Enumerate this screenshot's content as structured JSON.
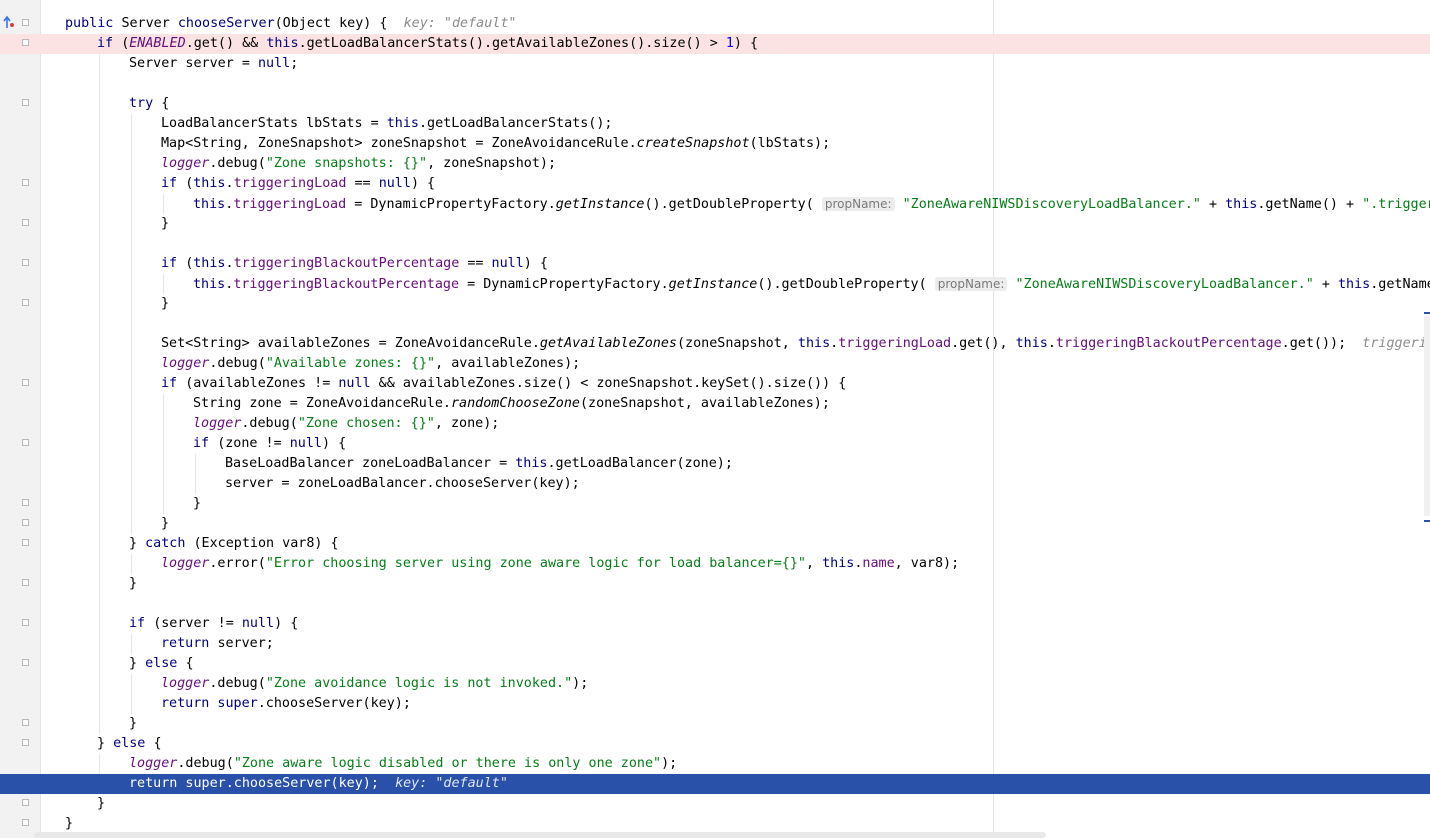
{
  "editor": {
    "lines": [
      {
        "parts": [
          [
            "kw",
            "public "
          ],
          [
            "",
            "Server "
          ],
          [
            "kw",
            "chooseServer"
          ],
          [
            "",
            "(Object key) {  "
          ],
          [
            "hint",
            "key: \"default\""
          ]
        ]
      },
      {
        "parts": [
          [
            "kw",
            "if "
          ],
          [
            "",
            "("
          ],
          [
            "fld ital",
            "ENABLED"
          ],
          [
            "",
            ".get() && "
          ],
          [
            "kw",
            "this"
          ],
          [
            "",
            ".getLoadBalancerStats().getAvailableZones().size() > "
          ],
          [
            "num",
            "1"
          ],
          [
            "",
            ") {"
          ]
        ]
      },
      {
        "parts": [
          [
            "",
            "Server server = "
          ],
          [
            "kw",
            "null"
          ],
          [
            "",
            ";"
          ]
        ]
      },
      {
        "parts": []
      },
      {
        "parts": [
          [
            "kw",
            "try "
          ],
          [
            "",
            "{"
          ]
        ]
      },
      {
        "parts": [
          [
            "",
            "LoadBalancerStats lbStats = "
          ],
          [
            "kw",
            "this"
          ],
          [
            "",
            ".getLoadBalancerStats();"
          ]
        ]
      },
      {
        "parts": [
          [
            "",
            "Map<String, ZoneSnapshot> zoneSnapshot = ZoneAvoidanceRule."
          ],
          [
            "ital",
            "createSnapshot"
          ],
          [
            "",
            "(lbStats);"
          ]
        ]
      },
      {
        "parts": [
          [
            "fld ital",
            "logger"
          ],
          [
            "",
            ".debug("
          ],
          [
            "str",
            "\"Zone snapshots: {}\""
          ],
          [
            "",
            ", zoneSnapshot);"
          ]
        ]
      },
      {
        "parts": [
          [
            "kw",
            "if "
          ],
          [
            "",
            "("
          ],
          [
            "kw",
            "this"
          ],
          [
            "",
            "."
          ],
          [
            "fld",
            "triggeringLoad"
          ],
          [
            "",
            " == "
          ],
          [
            "kw",
            "null"
          ],
          [
            "",
            ") {"
          ]
        ]
      },
      {
        "parts": [
          [
            "kw",
            "this"
          ],
          [
            "",
            "."
          ],
          [
            "fld",
            "triggeringLoad"
          ],
          [
            "",
            " = DynamicPropertyFactory."
          ],
          [
            "ital",
            "getInstance"
          ],
          [
            "",
            "().getDoubleProperty( "
          ],
          [
            "pn",
            "propName:"
          ],
          [
            "str",
            " \"ZoneAwareNIWSDiscoveryLoadBalancer.\""
          ],
          [
            "",
            " + "
          ],
          [
            "kw",
            "this"
          ],
          [
            "",
            ".getName() + "
          ],
          [
            "str",
            "\".triggering"
          ]
        ]
      },
      {
        "parts": [
          [
            "",
            "}"
          ]
        ]
      },
      {
        "parts": []
      },
      {
        "parts": [
          [
            "kw",
            "if "
          ],
          [
            "",
            "("
          ],
          [
            "kw",
            "this"
          ],
          [
            "",
            "."
          ],
          [
            "fld",
            "triggeringBlackoutPercentage"
          ],
          [
            "",
            " == "
          ],
          [
            "kw",
            "null"
          ],
          [
            "",
            ") {"
          ]
        ]
      },
      {
        "parts": [
          [
            "kw",
            "this"
          ],
          [
            "",
            "."
          ],
          [
            "fld",
            "triggeringBlackoutPercentage"
          ],
          [
            "",
            " = DynamicPropertyFactory."
          ],
          [
            "ital",
            "getInstance"
          ],
          [
            "",
            "().getDoubleProperty( "
          ],
          [
            "pn",
            "propName:"
          ],
          [
            "str",
            " \"ZoneAwareNIWSDiscoveryLoadBalancer.\""
          ],
          [
            "",
            " + "
          ],
          [
            "kw",
            "this"
          ],
          [
            "",
            ".getName("
          ]
        ]
      },
      {
        "parts": [
          [
            "",
            "}"
          ]
        ]
      },
      {
        "parts": []
      },
      {
        "parts": [
          [
            "",
            "Set<String> availableZones = ZoneAvoidanceRule."
          ],
          [
            "ital",
            "getAvailableZones"
          ],
          [
            "",
            "(zoneSnapshot, "
          ],
          [
            "kw",
            "this"
          ],
          [
            "",
            "."
          ],
          [
            "fld",
            "triggeringLoad"
          ],
          [
            "",
            ".get(), "
          ],
          [
            "kw",
            "this"
          ],
          [
            "",
            "."
          ],
          [
            "fld",
            "triggeringBlackoutPercentage"
          ],
          [
            "",
            ".get());  "
          ],
          [
            "hint",
            "triggerin"
          ]
        ]
      },
      {
        "parts": [
          [
            "fld ital",
            "logger"
          ],
          [
            "",
            ".debug("
          ],
          [
            "str",
            "\"Available zones: {}\""
          ],
          [
            "",
            ", availableZones);"
          ]
        ]
      },
      {
        "parts": [
          [
            "kw",
            "if "
          ],
          [
            "",
            "(availableZones != "
          ],
          [
            "kw",
            "null"
          ],
          [
            "",
            " && availableZones.size() < zoneSnapshot.keySet().size()) {"
          ]
        ]
      },
      {
        "parts": [
          [
            "",
            "String zone = ZoneAvoidanceRule."
          ],
          [
            "ital",
            "randomChooseZone"
          ],
          [
            "",
            "(zoneSnapshot, availableZones);"
          ]
        ]
      },
      {
        "parts": [
          [
            "fld ital",
            "logger"
          ],
          [
            "",
            ".debug("
          ],
          [
            "str",
            "\"Zone chosen: {}\""
          ],
          [
            "",
            ", zone);"
          ]
        ]
      },
      {
        "parts": [
          [
            "kw",
            "if "
          ],
          [
            "",
            "(zone != "
          ],
          [
            "kw",
            "null"
          ],
          [
            "",
            ") {"
          ]
        ]
      },
      {
        "parts": [
          [
            "",
            "BaseLoadBalancer zoneLoadBalancer = "
          ],
          [
            "kw",
            "this"
          ],
          [
            "",
            ".getLoadBalancer(zone);"
          ]
        ]
      },
      {
        "parts": [
          [
            "",
            "server = zoneLoadBalancer.chooseServer(key);"
          ]
        ]
      },
      {
        "parts": [
          [
            "",
            "}"
          ]
        ]
      },
      {
        "parts": [
          [
            "",
            "}"
          ]
        ]
      },
      {
        "parts": [
          [
            "",
            "} "
          ],
          [
            "kw",
            "catch "
          ],
          [
            "",
            "(Exception var8) {"
          ]
        ]
      },
      {
        "parts": [
          [
            "fld ital",
            "logger"
          ],
          [
            "",
            ".error("
          ],
          [
            "str",
            "\"Error choosing server using zone aware logic for load balancer={}\""
          ],
          [
            "",
            ", "
          ],
          [
            "kw",
            "this"
          ],
          [
            "",
            "."
          ],
          [
            "fld",
            "name"
          ],
          [
            "",
            ", var8);"
          ]
        ]
      },
      {
        "parts": [
          [
            "",
            "}"
          ]
        ]
      },
      {
        "parts": []
      },
      {
        "parts": [
          [
            "kw",
            "if "
          ],
          [
            "",
            "(server != "
          ],
          [
            "kw",
            "null"
          ],
          [
            "",
            ") {"
          ]
        ]
      },
      {
        "parts": [
          [
            "kw",
            "return "
          ],
          [
            "",
            "server;"
          ]
        ]
      },
      {
        "parts": [
          [
            "",
            "} "
          ],
          [
            "kw",
            "else "
          ],
          [
            "",
            "{"
          ]
        ]
      },
      {
        "parts": [
          [
            "fld ital",
            "logger"
          ],
          [
            "",
            ".debug("
          ],
          [
            "str",
            "\"Zone avoidance logic is not invoked.\""
          ],
          [
            "",
            ");"
          ]
        ]
      },
      {
        "parts": [
          [
            "kw",
            "return super"
          ],
          [
            "",
            ".chooseServer(key);"
          ]
        ]
      },
      {
        "parts": [
          [
            "",
            "}"
          ]
        ]
      },
      {
        "parts": [
          [
            "",
            "} "
          ],
          [
            "kw",
            "else "
          ],
          [
            "",
            "{"
          ]
        ]
      },
      {
        "parts": [
          [
            "fld ital",
            "logger"
          ],
          [
            "",
            ".debug("
          ],
          [
            "str",
            "\"Zone aware logic disabled or there is only one zone\""
          ],
          [
            "",
            ");"
          ]
        ]
      },
      {
        "parts": [
          [
            "kw",
            "return super"
          ],
          [
            "",
            ".chooseServer(key);  "
          ],
          [
            "hint",
            "key: \"default\""
          ]
        ]
      },
      {
        "parts": [
          [
            "",
            "}"
          ]
        ]
      },
      {
        "parts": [
          [
            "",
            "}"
          ]
        ]
      }
    ]
  }
}
